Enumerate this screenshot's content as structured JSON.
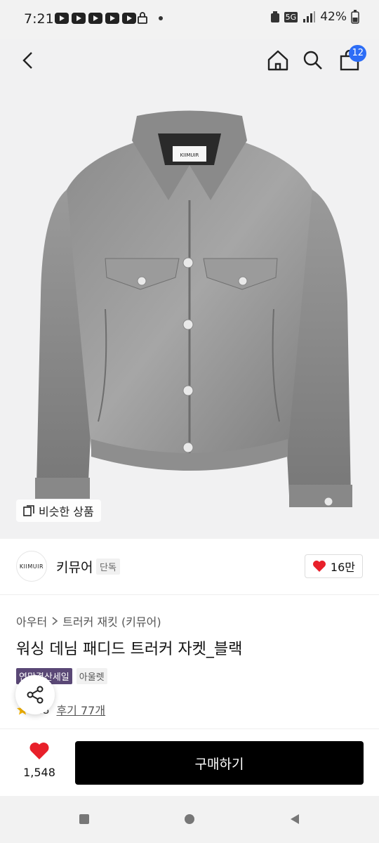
{
  "status_bar": {
    "time": "7:21",
    "network": "5G",
    "battery": "42%",
    "icons": [
      "youtube-icon",
      "youtube-icon",
      "youtube-icon",
      "youtube-icon",
      "youtube-icon",
      "lock-icon"
    ]
  },
  "top_nav": {
    "back_icon": "chevron-left-icon",
    "home_icon": "home-icon",
    "search_icon": "search-icon",
    "cart_icon": "shopping-bag-icon",
    "cart_count": "12",
    "cart_badge_color": "#2d6df6"
  },
  "hero": {
    "similar_label": "비슷한 상품",
    "collar_label": "KIIMUIR"
  },
  "brand": {
    "logo_text": "KIIMUIR",
    "name": "키뮤어",
    "tag": "단독",
    "likes": "16만"
  },
  "product": {
    "breadcrumb": [
      "아우터",
      "트러커 재킷 (키뮤어)"
    ],
    "title": "워싱 데님 패디드 트러커 자켓_블랙",
    "badges": [
      "연말결산세일",
      "아울렛"
    ],
    "rating": "4.8",
    "review_label": "후기 77개"
  },
  "bottom_bar": {
    "favorite_count": "1,548",
    "buy_label": "구매하기",
    "heart_color": "#e8202a"
  },
  "colors": {
    "sale_badge": "#5a4876",
    "buy_button": "#000000"
  }
}
